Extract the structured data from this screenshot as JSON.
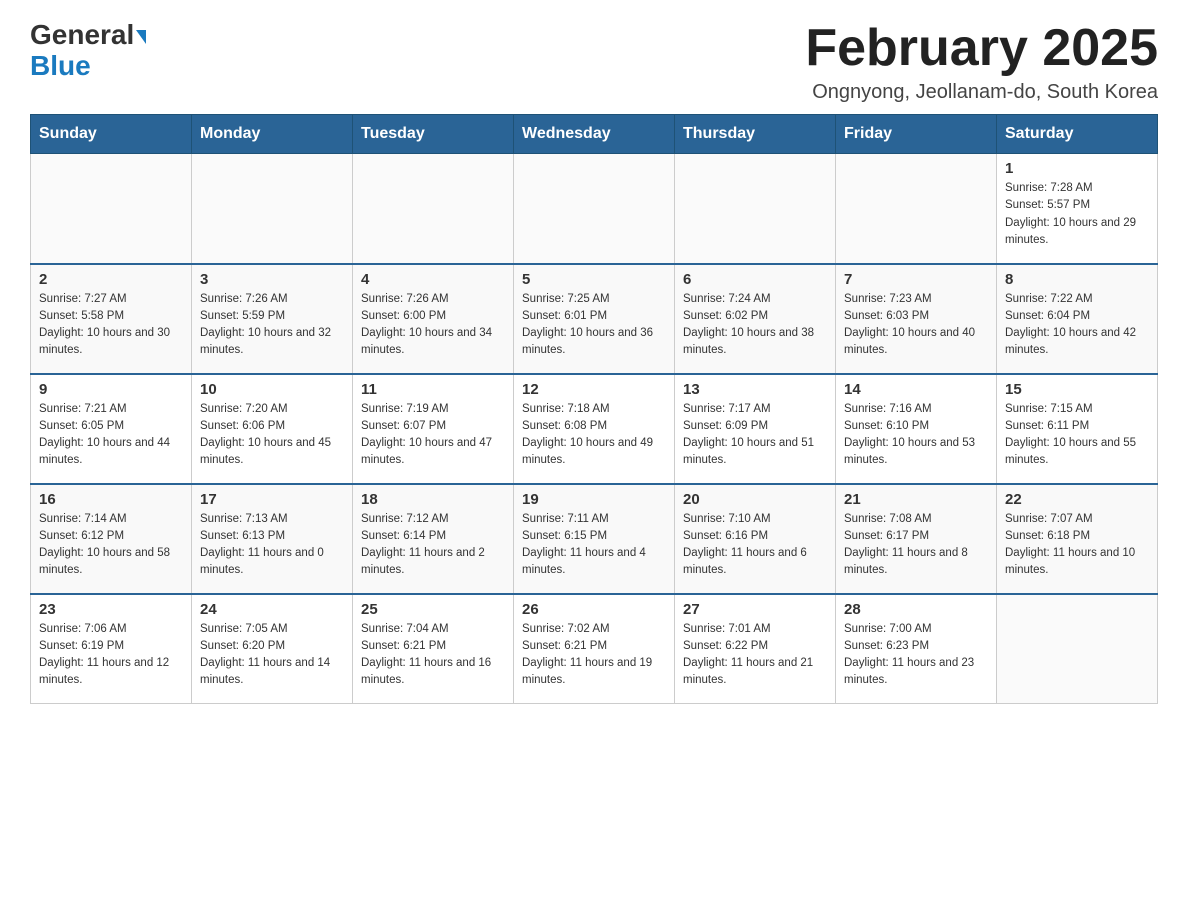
{
  "header": {
    "logo_general": "General",
    "logo_blue": "Blue",
    "month_title": "February 2025",
    "location": "Ongnyong, Jeollanam-do, South Korea"
  },
  "days_of_week": [
    "Sunday",
    "Monday",
    "Tuesday",
    "Wednesday",
    "Thursday",
    "Friday",
    "Saturday"
  ],
  "weeks": [
    {
      "days": [
        {
          "num": "",
          "info": ""
        },
        {
          "num": "",
          "info": ""
        },
        {
          "num": "",
          "info": ""
        },
        {
          "num": "",
          "info": ""
        },
        {
          "num": "",
          "info": ""
        },
        {
          "num": "",
          "info": ""
        },
        {
          "num": "1",
          "info": "Sunrise: 7:28 AM\nSunset: 5:57 PM\nDaylight: 10 hours and 29 minutes."
        }
      ]
    },
    {
      "days": [
        {
          "num": "2",
          "info": "Sunrise: 7:27 AM\nSunset: 5:58 PM\nDaylight: 10 hours and 30 minutes."
        },
        {
          "num": "3",
          "info": "Sunrise: 7:26 AM\nSunset: 5:59 PM\nDaylight: 10 hours and 32 minutes."
        },
        {
          "num": "4",
          "info": "Sunrise: 7:26 AM\nSunset: 6:00 PM\nDaylight: 10 hours and 34 minutes."
        },
        {
          "num": "5",
          "info": "Sunrise: 7:25 AM\nSunset: 6:01 PM\nDaylight: 10 hours and 36 minutes."
        },
        {
          "num": "6",
          "info": "Sunrise: 7:24 AM\nSunset: 6:02 PM\nDaylight: 10 hours and 38 minutes."
        },
        {
          "num": "7",
          "info": "Sunrise: 7:23 AM\nSunset: 6:03 PM\nDaylight: 10 hours and 40 minutes."
        },
        {
          "num": "8",
          "info": "Sunrise: 7:22 AM\nSunset: 6:04 PM\nDaylight: 10 hours and 42 minutes."
        }
      ]
    },
    {
      "days": [
        {
          "num": "9",
          "info": "Sunrise: 7:21 AM\nSunset: 6:05 PM\nDaylight: 10 hours and 44 minutes."
        },
        {
          "num": "10",
          "info": "Sunrise: 7:20 AM\nSunset: 6:06 PM\nDaylight: 10 hours and 45 minutes."
        },
        {
          "num": "11",
          "info": "Sunrise: 7:19 AM\nSunset: 6:07 PM\nDaylight: 10 hours and 47 minutes."
        },
        {
          "num": "12",
          "info": "Sunrise: 7:18 AM\nSunset: 6:08 PM\nDaylight: 10 hours and 49 minutes."
        },
        {
          "num": "13",
          "info": "Sunrise: 7:17 AM\nSunset: 6:09 PM\nDaylight: 10 hours and 51 minutes."
        },
        {
          "num": "14",
          "info": "Sunrise: 7:16 AM\nSunset: 6:10 PM\nDaylight: 10 hours and 53 minutes."
        },
        {
          "num": "15",
          "info": "Sunrise: 7:15 AM\nSunset: 6:11 PM\nDaylight: 10 hours and 55 minutes."
        }
      ]
    },
    {
      "days": [
        {
          "num": "16",
          "info": "Sunrise: 7:14 AM\nSunset: 6:12 PM\nDaylight: 10 hours and 58 minutes."
        },
        {
          "num": "17",
          "info": "Sunrise: 7:13 AM\nSunset: 6:13 PM\nDaylight: 11 hours and 0 minutes."
        },
        {
          "num": "18",
          "info": "Sunrise: 7:12 AM\nSunset: 6:14 PM\nDaylight: 11 hours and 2 minutes."
        },
        {
          "num": "19",
          "info": "Sunrise: 7:11 AM\nSunset: 6:15 PM\nDaylight: 11 hours and 4 minutes."
        },
        {
          "num": "20",
          "info": "Sunrise: 7:10 AM\nSunset: 6:16 PM\nDaylight: 11 hours and 6 minutes."
        },
        {
          "num": "21",
          "info": "Sunrise: 7:08 AM\nSunset: 6:17 PM\nDaylight: 11 hours and 8 minutes."
        },
        {
          "num": "22",
          "info": "Sunrise: 7:07 AM\nSunset: 6:18 PM\nDaylight: 11 hours and 10 minutes."
        }
      ]
    },
    {
      "days": [
        {
          "num": "23",
          "info": "Sunrise: 7:06 AM\nSunset: 6:19 PM\nDaylight: 11 hours and 12 minutes."
        },
        {
          "num": "24",
          "info": "Sunrise: 7:05 AM\nSunset: 6:20 PM\nDaylight: 11 hours and 14 minutes."
        },
        {
          "num": "25",
          "info": "Sunrise: 7:04 AM\nSunset: 6:21 PM\nDaylight: 11 hours and 16 minutes."
        },
        {
          "num": "26",
          "info": "Sunrise: 7:02 AM\nSunset: 6:21 PM\nDaylight: 11 hours and 19 minutes."
        },
        {
          "num": "27",
          "info": "Sunrise: 7:01 AM\nSunset: 6:22 PM\nDaylight: 11 hours and 21 minutes."
        },
        {
          "num": "28",
          "info": "Sunrise: 7:00 AM\nSunset: 6:23 PM\nDaylight: 11 hours and 23 minutes."
        },
        {
          "num": "",
          "info": ""
        }
      ]
    }
  ]
}
